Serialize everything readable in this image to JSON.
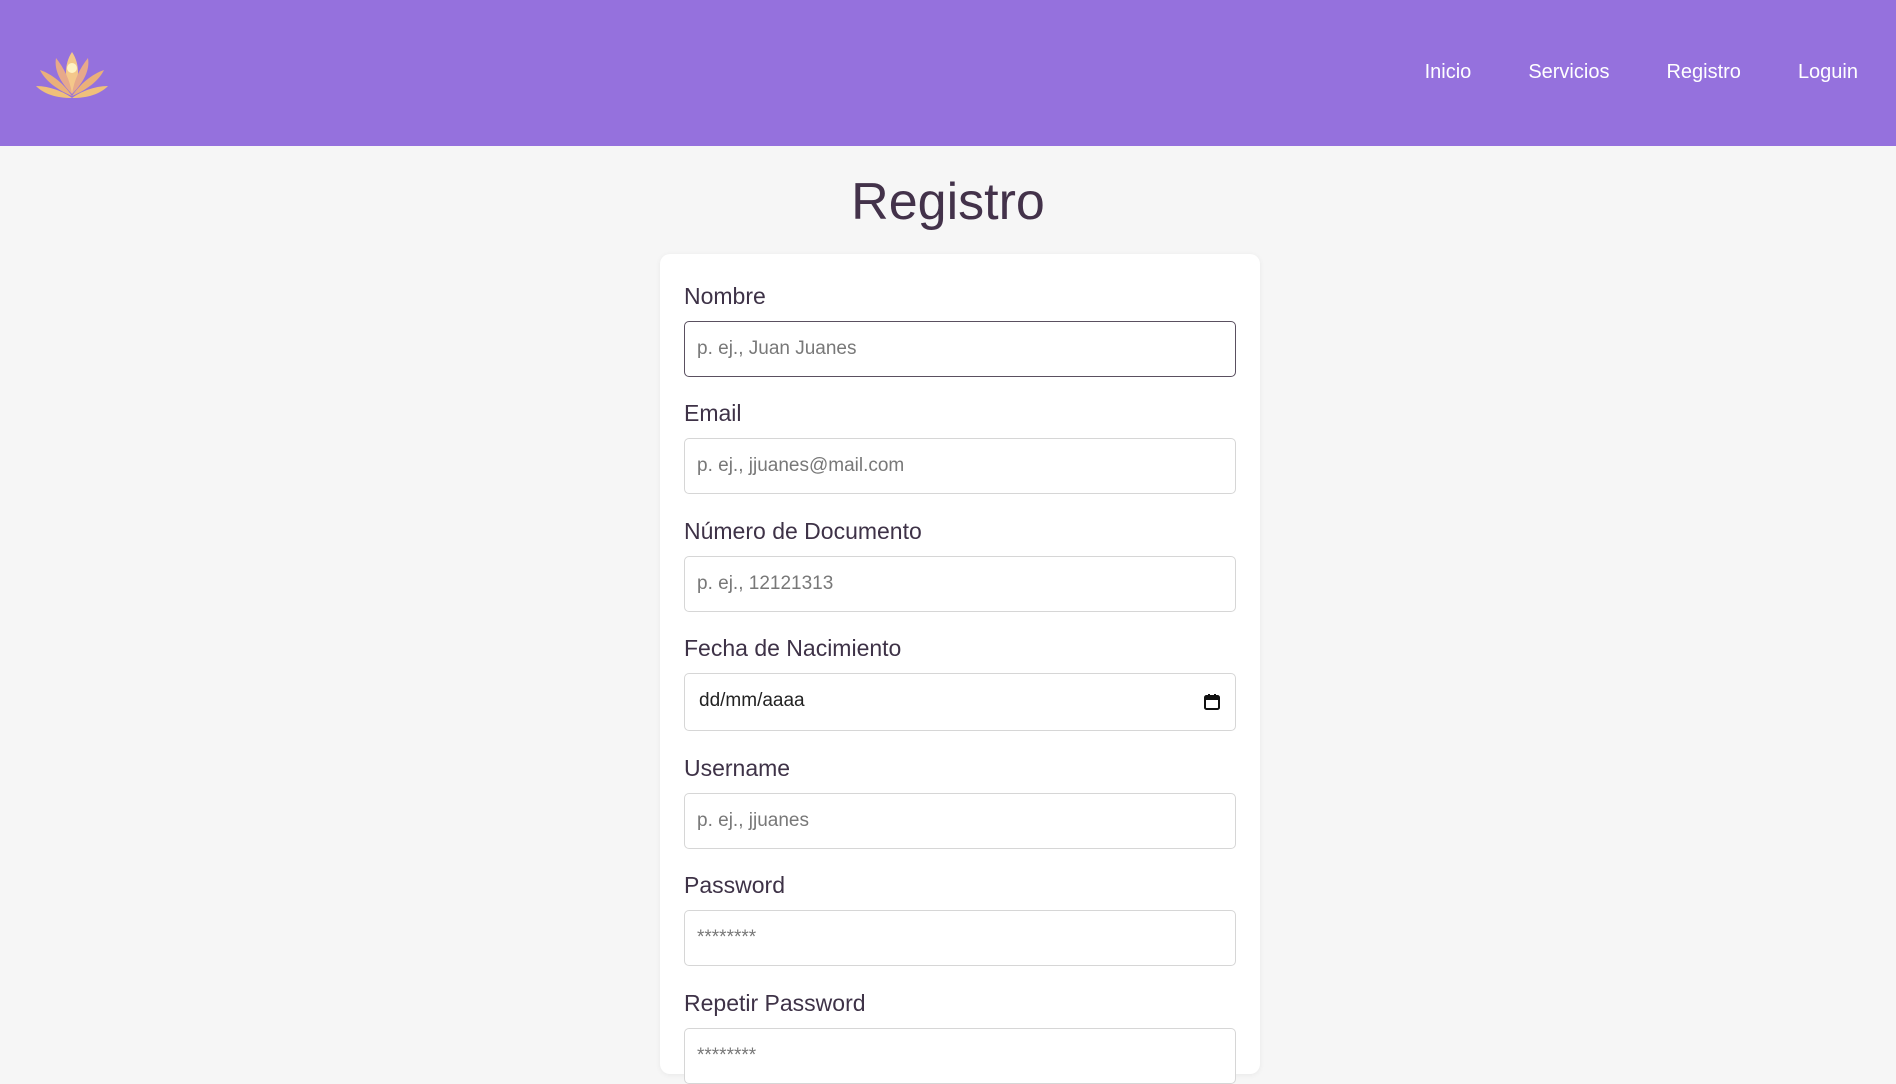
{
  "nav": {
    "items": [
      {
        "label": "Inicio"
      },
      {
        "label": "Servicios"
      },
      {
        "label": "Registro"
      },
      {
        "label": "Loguin"
      }
    ]
  },
  "logo": {
    "icon": "lotus-logo-icon"
  },
  "page": {
    "title": "Registro"
  },
  "form": {
    "nombre": {
      "label": "Nombre",
      "placeholder": "p. ej., Juan Juanes"
    },
    "email": {
      "label": "Email",
      "placeholder": "p. ej., jjuanes@mail.com"
    },
    "documento": {
      "label": "Número de Documento",
      "placeholder": "p. ej., 12121313"
    },
    "fecha": {
      "label": "Fecha de Nacimiento",
      "value": "dd/mm/aaaa"
    },
    "username": {
      "label": "Username",
      "placeholder": "p. ej., jjuanes"
    },
    "password": {
      "label": "Password",
      "placeholder": "********"
    },
    "repetir": {
      "label": "Repetir Password",
      "placeholder": "********"
    }
  },
  "colors": {
    "header": "#9571dd",
    "background": "#f6f6f6",
    "title": "#43324a"
  }
}
